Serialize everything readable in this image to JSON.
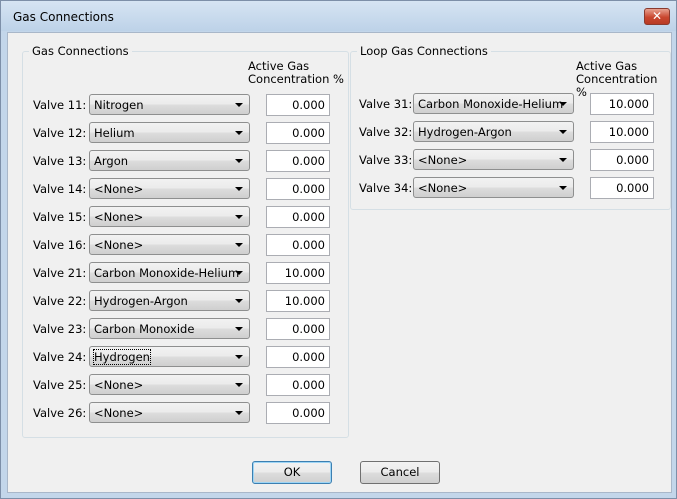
{
  "window": {
    "title": "Gas Connections"
  },
  "gas_group": {
    "legend": "Gas Connections",
    "header_line1": "Active Gas",
    "header_line2": "Concentration %",
    "rows": [
      {
        "label": "Valve 11:",
        "gas": "Nitrogen",
        "conc": "0.000"
      },
      {
        "label": "Valve 12:",
        "gas": "Helium",
        "conc": "0.000"
      },
      {
        "label": "Valve 13:",
        "gas": "Argon",
        "conc": "0.000"
      },
      {
        "label": "Valve 14:",
        "gas": "<None>",
        "conc": "0.000"
      },
      {
        "label": "Valve 15:",
        "gas": "<None>",
        "conc": "0.000"
      },
      {
        "label": "Valve 16:",
        "gas": "<None>",
        "conc": "0.000"
      },
      {
        "label": "Valve 21:",
        "gas": "Carbon Monoxide-Helium",
        "conc": "10.000"
      },
      {
        "label": "Valve 22:",
        "gas": "Hydrogen-Argon",
        "conc": "10.000"
      },
      {
        "label": "Valve 23:",
        "gas": "Carbon Monoxide",
        "conc": "0.000"
      },
      {
        "label": "Valve 24:",
        "gas": "Hydrogen",
        "conc": "0.000"
      },
      {
        "label": "Valve 25:",
        "gas": "<None>",
        "conc": "0.000"
      },
      {
        "label": "Valve 26:",
        "gas": "<None>",
        "conc": "0.000"
      }
    ]
  },
  "loop_group": {
    "legend": "Loop Gas Connections",
    "header_line1": "Active Gas",
    "header_line2": "Concentration %",
    "rows": [
      {
        "label": "Valve 31:",
        "gas": "Carbon Monoxide-Helium",
        "conc": "10.000"
      },
      {
        "label": "Valve 32:",
        "gas": "Hydrogen-Argon",
        "conc": "10.000"
      },
      {
        "label": "Valve 33:",
        "gas": "<None>",
        "conc": "0.000"
      },
      {
        "label": "Valve 34:",
        "gas": "<None>",
        "conc": "0.000"
      }
    ]
  },
  "buttons": {
    "ok": "OK",
    "cancel": "Cancel"
  },
  "icons": {
    "close": "close-icon",
    "dropdown": "chevron-down-icon"
  },
  "colors": {
    "titlebar": "#c3d6ea",
    "close_button": "#c9472f",
    "client_bg": "#f0f0f0"
  }
}
